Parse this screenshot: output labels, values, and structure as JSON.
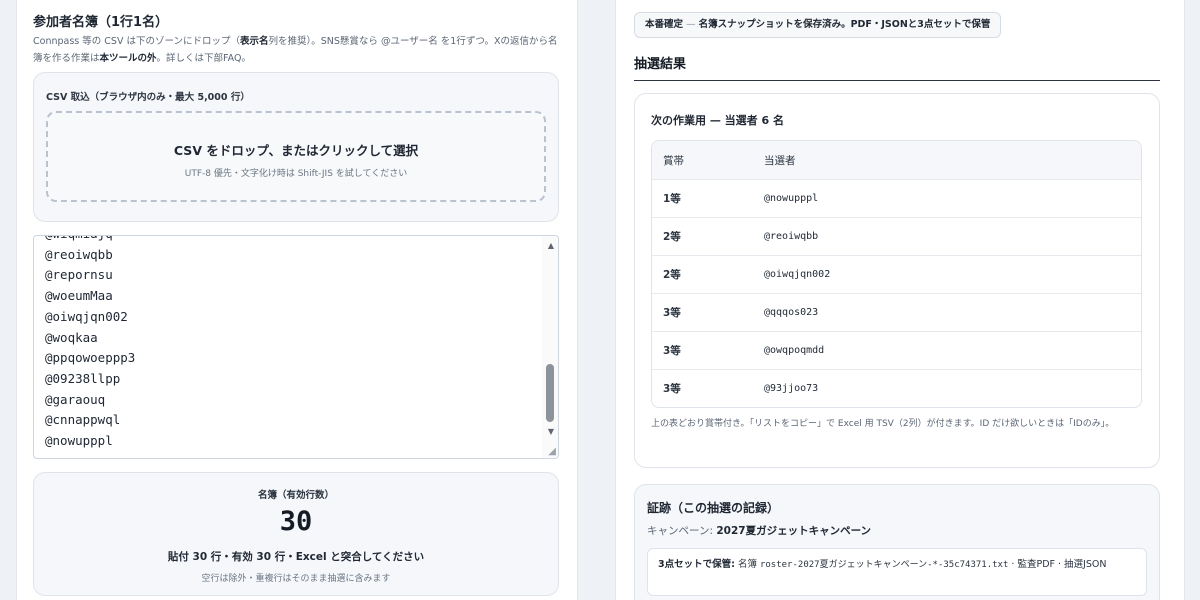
{
  "left": {
    "title": "参加者名簿（1行1名）",
    "desc": {
      "p1": "Connpass 等の CSV は下のゾーンにドロップ（",
      "p2": "表示名",
      "p3": "列を推奨）。SNS懸賞なら @ユーザー名 を1行ずつ。Xの返信から名簿を作る作業は",
      "p4": "本ツールの外",
      "p5": "。詳しくは下部FAQ。"
    },
    "csv": {
      "label": "CSV 取込（ブラウザ内のみ・最大 5,000 行）",
      "drop_main": "CSV をドロップ、またはクリックして選択",
      "drop_sub": "UTF-8 優先・文字化け時は Shift-JIS を試してください"
    },
    "roster_text": "@wiqmiajq\n@reoiwqbb\n@repornsu\n@woeumMaa\n@oiwqjqn002\n@woqkaa\n@ppqowoeppp3\n@09238llpp\n@garaouq\n@cnnappwql\n@nowupppl",
    "count": {
      "label": "名簿（有効行数）",
      "value": "30",
      "note": "貼付 30 行・有効 30 行・Excel と突合してください",
      "sub": "空行は除外・重複行はそのまま抽選に含みます"
    }
  },
  "right": {
    "status": {
      "strong": "本番確定",
      "sep": " — ",
      "text": "名簿スナップショットを保存済み。PDF・JSONと3点セットで保管"
    },
    "results_title": "抽選結果",
    "winners": {
      "heading": "次の作業用 — 当選者 6 名",
      "col_prize": "賞帯",
      "col_user": "当選者",
      "rows": [
        {
          "prize": "1等",
          "user": "@nowupppl"
        },
        {
          "prize": "2等",
          "user": "@reoiwqbb"
        },
        {
          "prize": "2等",
          "user": "@oiwqjqn002"
        },
        {
          "prize": "3等",
          "user": "@qqqos023"
        },
        {
          "prize": "3等",
          "user": "@owqpoqmdd"
        },
        {
          "prize": "3等",
          "user": "@93jjoo73"
        }
      ],
      "note": "上の表どおり賞帯付き。「リストをコピー」で Excel 用 TSV（2列）が付きます。ID だけ欲しいときは「IDのみ」。"
    },
    "evidence": {
      "title": "証跡（この抽選の記録）",
      "campaign_label": "キャンペーン: ",
      "campaign_name": "2027夏ガジェットキャンペーン",
      "save_label": "3点セットで保管:",
      "save_text1": " 名簿 ",
      "save_file": "roster-2027夏ガジェットキャンペーン-*-35c74371.txt",
      "save_text2": " · 監査PDF · 抽選JSON"
    }
  }
}
